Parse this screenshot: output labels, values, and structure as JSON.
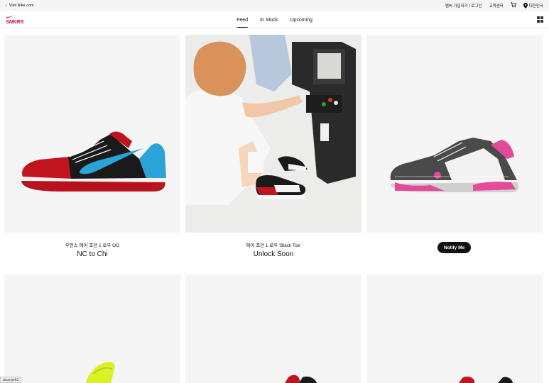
{
  "utility_bar": {
    "back_label": "Visit Nike.com",
    "join_login": "멤버 가입하기 / 로그인",
    "customer_center": "고객센터",
    "region": "대한민국"
  },
  "header": {
    "logo_text": "SNKRS",
    "tabs": [
      {
        "label": "Feed",
        "active": true
      },
      {
        "label": "In Stock",
        "active": false
      },
      {
        "label": "Upcoming",
        "active": false
      }
    ]
  },
  "products": [
    {
      "subtitle": "우먼스 에어 조던 1 로우 OG",
      "title": "NC to Chi"
    },
    {
      "subtitle": "에어 조던 1 로우 'Black Toe'",
      "title": "Unlock Soon"
    },
    {
      "button_label": "Notify Me"
    }
  ],
  "status_url": "arca-jerk1",
  "colors": {
    "brand_red": "#c8102e",
    "tile_bg": "#f5f5f5",
    "text": "#111111"
  }
}
